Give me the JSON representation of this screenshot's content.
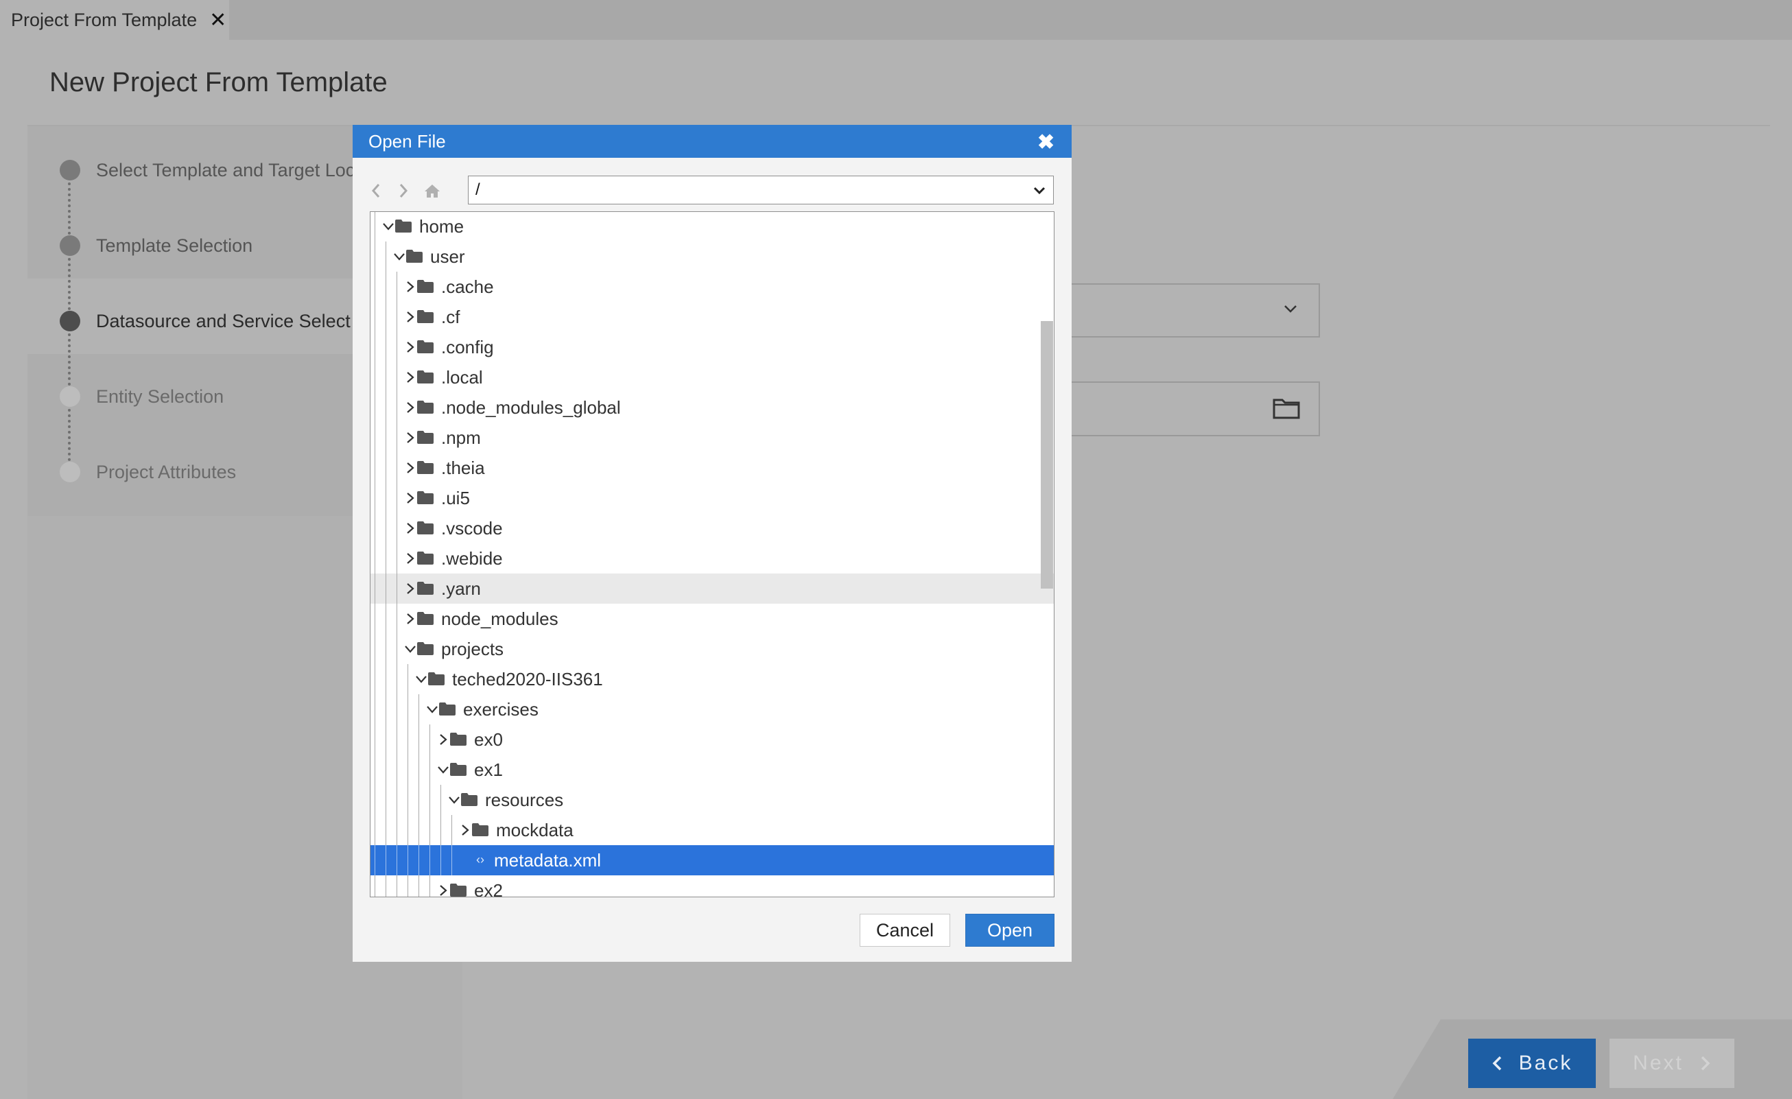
{
  "tab": {
    "title": "Project From Template",
    "close_glyph": "✕"
  },
  "page": {
    "title": "New Project From Template"
  },
  "wizard": {
    "steps": [
      {
        "label": "Select Template and Target Loc",
        "state": "done"
      },
      {
        "label": "Template Selection",
        "state": "done"
      },
      {
        "label": "Datasource and Service Select",
        "state": "current"
      },
      {
        "label": "Entity Selection",
        "state": "future"
      },
      {
        "label": "Project Attributes",
        "state": "future"
      }
    ],
    "back_label": "Back",
    "next_label": "Next"
  },
  "dialog": {
    "title": "Open File",
    "close_glyph": "✖",
    "path": "/",
    "cancel_label": "Cancel",
    "open_label": "Open",
    "tree": [
      {
        "label": "home",
        "depth": 0,
        "type": "folder",
        "expanded": true
      },
      {
        "label": "user",
        "depth": 1,
        "type": "folder",
        "expanded": true
      },
      {
        "label": ".cache",
        "depth": 2,
        "type": "folder",
        "expanded": false
      },
      {
        "label": ".cf",
        "depth": 2,
        "type": "folder",
        "expanded": false
      },
      {
        "label": ".config",
        "depth": 2,
        "type": "folder",
        "expanded": false
      },
      {
        "label": ".local",
        "depth": 2,
        "type": "folder",
        "expanded": false
      },
      {
        "label": ".node_modules_global",
        "depth": 2,
        "type": "folder",
        "expanded": false
      },
      {
        "label": ".npm",
        "depth": 2,
        "type": "folder",
        "expanded": false
      },
      {
        "label": ".theia",
        "depth": 2,
        "type": "folder",
        "expanded": false
      },
      {
        "label": ".ui5",
        "depth": 2,
        "type": "folder",
        "expanded": false
      },
      {
        "label": ".vscode",
        "depth": 2,
        "type": "folder",
        "expanded": false
      },
      {
        "label": ".webide",
        "depth": 2,
        "type": "folder",
        "expanded": false
      },
      {
        "label": ".yarn",
        "depth": 2,
        "type": "folder",
        "expanded": false,
        "hover": true
      },
      {
        "label": "node_modules",
        "depth": 2,
        "type": "folder",
        "expanded": false
      },
      {
        "label": "projects",
        "depth": 2,
        "type": "folder",
        "expanded": true
      },
      {
        "label": "teched2020-IIS361",
        "depth": 3,
        "type": "folder",
        "expanded": true
      },
      {
        "label": "exercises",
        "depth": 4,
        "type": "folder",
        "expanded": true
      },
      {
        "label": "ex0",
        "depth": 5,
        "type": "folder",
        "expanded": false
      },
      {
        "label": "ex1",
        "depth": 5,
        "type": "folder",
        "expanded": true
      },
      {
        "label": "resources",
        "depth": 6,
        "type": "folder",
        "expanded": true
      },
      {
        "label": "mockdata",
        "depth": 7,
        "type": "folder",
        "expanded": false
      },
      {
        "label": "metadata.xml",
        "depth": 7,
        "type": "file",
        "selected": true
      },
      {
        "label": "ex2",
        "depth": 5,
        "type": "folder",
        "expanded": false
      }
    ]
  }
}
